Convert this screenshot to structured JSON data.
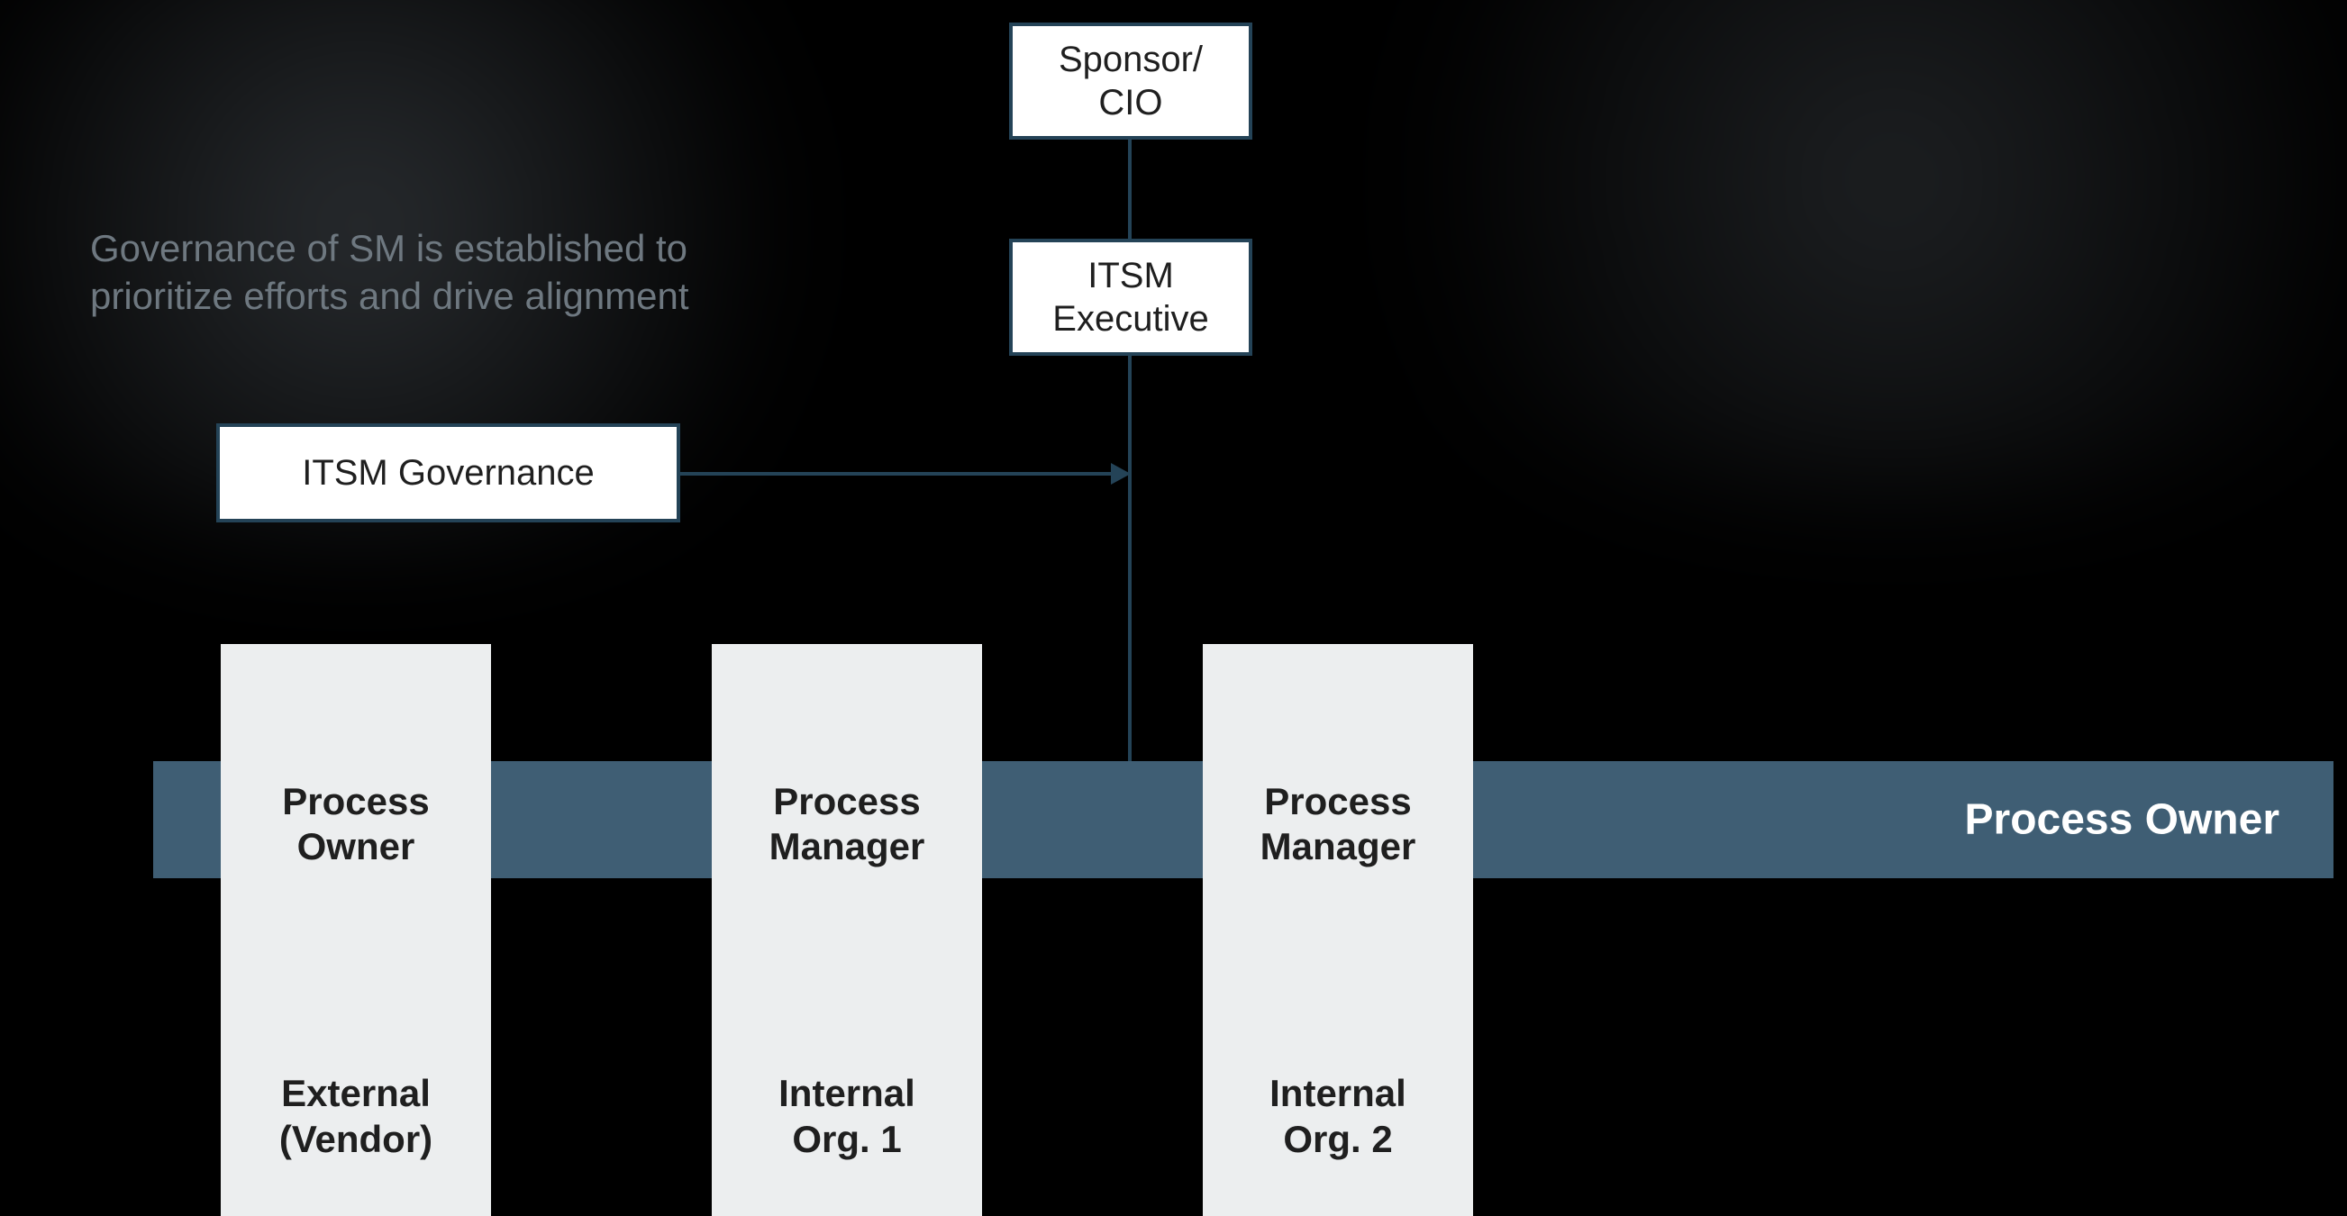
{
  "caption_line1": "Governance of SM is established to",
  "caption_line2": "prioritize efforts and drive alignment",
  "top_sponsor_line1": "Sponsor/",
  "top_sponsor_line2": "CIO",
  "itsm_exec_line1": "ITSM",
  "itsm_exec_line2": "Executive",
  "governance_label": "ITSM Governance",
  "bar_right_label": "Process Owner",
  "pillars": [
    {
      "role_line1": "Process",
      "role_line2": "Owner",
      "org_line1": "External",
      "org_line2": "(Vendor)"
    },
    {
      "role_line1": "Process",
      "role_line2": "Manager",
      "org_line1": "Internal",
      "org_line2": "Org. 1"
    },
    {
      "role_line1": "Process",
      "role_line2": "Manager",
      "org_line1": "Internal",
      "org_line2": "Org. 2"
    }
  ],
  "colors": {
    "box_border": "#244357",
    "bar_fill": "#3f5e74",
    "pillar_bg": "#eceeef",
    "caption": "#6e7880"
  }
}
